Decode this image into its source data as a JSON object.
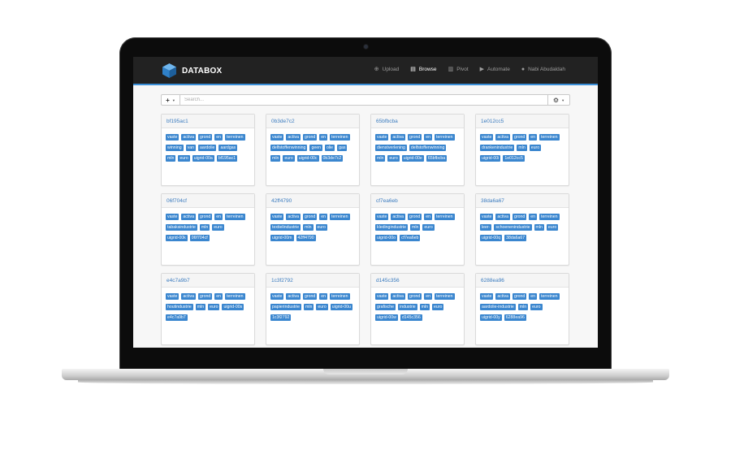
{
  "app": {
    "brand": "DATABOX",
    "accent": "#3a8fd8",
    "tag_color": "#3a86cf"
  },
  "nav": [
    {
      "label": "Upload",
      "icon": "upload-icon",
      "glyph": "⊕",
      "active": false
    },
    {
      "label": "Browse",
      "icon": "file-icon",
      "glyph": "▤",
      "active": true
    },
    {
      "label": "Pivot",
      "icon": "bar-chart-icon",
      "glyph": "▥",
      "active": false
    },
    {
      "label": "Automate",
      "icon": "play-icon",
      "glyph": "▶",
      "active": false
    },
    {
      "label": "Nabi Abudaldah",
      "icon": "user-icon",
      "glyph": "●",
      "active": false
    }
  ],
  "toolbar": {
    "add_label": "+",
    "add_caret": "▼",
    "search_placeholder": "Search...",
    "settings_label": "⚙",
    "settings_caret": "▼"
  },
  "cards": [
    {
      "title": "bf195ac1",
      "tags": [
        "vaste",
        "activa",
        "grond",
        "en",
        "terreinen",
        "winning",
        "van",
        "aardolie",
        "aardgas",
        "mln",
        "euro",
        "uigrid-00a",
        "bf195ac1"
      ]
    },
    {
      "title": "0b3de7c2",
      "tags": [
        "vaste",
        "activa",
        "grond",
        "en",
        "terreinen",
        "delfstoffenwinning",
        "geen",
        "olie",
        "gas",
        "mln",
        "euro",
        "uigrid-00c",
        "0b3de7c2"
      ]
    },
    {
      "title": "65bfbcba",
      "tags": [
        "vaste",
        "activa",
        "grond",
        "en",
        "terreinen",
        "dienstverlening",
        "delfstoffenwinning",
        "mln",
        "euro",
        "uigrid-00e",
        "65bfbcba"
      ]
    },
    {
      "title": "1e012cc5",
      "tags": [
        "vaste",
        "activa",
        "grond",
        "en",
        "terreinen",
        "drankenindustrie",
        "mln",
        "euro",
        "uigrid-00i",
        "1e012cc5"
      ]
    },
    {
      "title": "06f704cf",
      "tags": [
        "vaste",
        "activa",
        "grond",
        "en",
        "terreinen",
        "tabaksindustrie",
        "mln",
        "euro",
        "uigrid-00k",
        "06f704cf"
      ]
    },
    {
      "title": "42ff4790",
      "tags": [
        "vaste",
        "activa",
        "grond",
        "en",
        "terreinen",
        "textielindustrie",
        "mln",
        "euro",
        "uigrid-00m",
        "42ff4790"
      ]
    },
    {
      "title": "cf7ea6eb",
      "tags": [
        "vaste",
        "activa",
        "grond",
        "en",
        "terreinen",
        "kledingindustrie",
        "mln",
        "euro",
        "uigrid-00o",
        "cf7ea6eb"
      ]
    },
    {
      "title": "38da6a67",
      "tags": [
        "vaste",
        "activa",
        "grond",
        "en",
        "terreinen",
        "leer-",
        "schoenenindustrie",
        "mln",
        "euro",
        "uigrid-00q",
        "38da6a67"
      ]
    },
    {
      "title": "e4c7a9b7",
      "tags": [
        "vaste",
        "activa",
        "grond",
        "en",
        "terreinen",
        "houtindustrie",
        "mln",
        "euro",
        "uigrid-00s",
        "e4c7a9b7"
      ]
    },
    {
      "title": "1c3f2792",
      "tags": [
        "vaste",
        "activa",
        "grond",
        "en",
        "terreinen",
        "papierindustrie",
        "mln",
        "euro",
        "uigrid-00u",
        "1c3f2792"
      ]
    },
    {
      "title": "d145c356",
      "tags": [
        "vaste",
        "activa",
        "grond",
        "en",
        "terreinen",
        "grafische",
        "industrie",
        "mln",
        "euro",
        "uigrid-00w",
        "d145c356"
      ]
    },
    {
      "title": "6288ea96",
      "tags": [
        "vaste",
        "activa",
        "grond",
        "en",
        "terreinen",
        "aardolie-industrie",
        "mln",
        "euro",
        "uigrid-00y",
        "6288ea96"
      ]
    }
  ]
}
